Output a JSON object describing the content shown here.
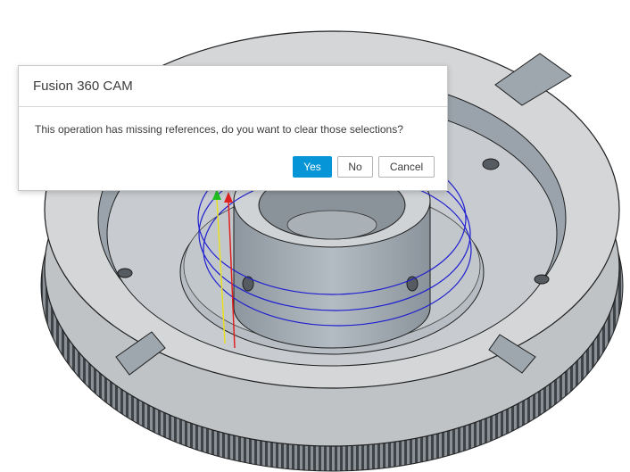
{
  "dialog": {
    "title": "Fusion 360 CAM",
    "message": "This operation has missing references, do you want to clear those selections?",
    "buttons": {
      "yes": "Yes",
      "no": "No",
      "cancel": "Cancel"
    },
    "primary_color": "#0696d7"
  },
  "viewport": {
    "model_color": "#d4d6d8",
    "toolpath_color": "#1f1fd0",
    "axis_colors": {
      "x": "#e02020",
      "y": "#e8e020",
      "z": "#20c020"
    }
  }
}
